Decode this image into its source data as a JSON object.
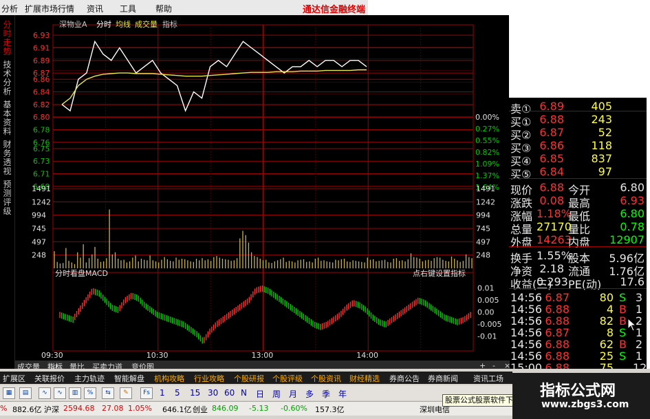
{
  "menu": {
    "items": [
      "分析",
      "扩展市场行情",
      "资讯",
      "工具",
      "帮助"
    ],
    "brand": "通达信金融终端"
  },
  "side_tabs": [
    "分时走势",
    "技术分析",
    "基本资料",
    "财务透视",
    "预测评级"
  ],
  "chart_header": {
    "stock_name": "深物业A",
    "mode": "分时",
    "avg_label": "均线",
    "vol_label": "成交量",
    "indicator_label": "指标"
  },
  "macd_header": {
    "title": "分时看盘MACD",
    "hint": "点右键设置指标"
  },
  "chart_data": [
    {
      "type": "line",
      "title": "",
      "xlabel": "",
      "ylabel": "",
      "price_ticks_left": [
        "6.93",
        "6.91",
        "6.89",
        "6.87",
        "6.86",
        "6.84",
        "6.82",
        "6.80",
        "6.78",
        "6.76",
        "6.75",
        "6.73",
        "6.71",
        "6.69"
      ],
      "pct_ticks_right": [
        "0.00%",
        "0.27%",
        "0.55%",
        "0.82%",
        "1.09%",
        "1.37%",
        "1.64%"
      ],
      "x_ticks": [
        "09:30",
        "10:30",
        "13:00",
        "14:00"
      ],
      "ylim": [
        6.68,
        6.94
      ],
      "prev_close": 6.8,
      "series": [
        {
          "values": [
            6.82,
            6.81,
            6.86,
            6.87,
            6.92,
            6.9,
            6.89,
            6.91,
            6.89,
            6.87,
            6.88,
            6.89,
            6.87,
            6.86,
            6.85,
            6.81,
            6.84,
            6.83,
            6.88,
            6.89,
            6.88,
            6.9,
            6.92,
            6.91,
            6.9,
            6.89,
            6.88,
            6.87,
            6.88,
            6.88,
            6.89,
            6.88,
            6.89,
            6.89,
            6.88,
            6.89,
            6.89,
            6.88
          ]
        },
        {
          "values": [
            6.82,
            6.83,
            6.85,
            6.86,
            6.865,
            6.868,
            6.869,
            6.87,
            6.87,
            6.869,
            6.869,
            6.869,
            6.868,
            6.867,
            6.866,
            6.865,
            6.865,
            6.865,
            6.866,
            6.867,
            6.868,
            6.869,
            6.87,
            6.871,
            6.871,
            6.871,
            6.872,
            6.872,
            6.872,
            6.873,
            6.873,
            6.873,
            6.874,
            6.874,
            6.874,
            6.874,
            6.875,
            6.875
          ]
        }
      ]
    },
    {
      "type": "bar",
      "title": "",
      "y_ticks": [
        "1491",
        "1242",
        "994",
        "745",
        "497",
        "248"
      ],
      "ylim": [
        0,
        1491
      ],
      "values": [
        320,
        120,
        90,
        100,
        380,
        140,
        110,
        80,
        300,
        200,
        450,
        110,
        190,
        260,
        400,
        180,
        120,
        130,
        190,
        1100,
        260,
        300,
        180,
        150,
        160,
        110,
        130,
        200,
        240,
        130,
        180,
        160,
        150,
        240,
        150,
        130,
        110,
        160,
        210,
        170,
        140,
        130,
        200,
        160,
        180,
        170,
        150,
        130,
        120,
        180,
        150,
        190,
        150,
        170,
        140,
        210,
        230,
        200,
        180,
        170,
        160,
        140,
        150,
        190,
        560,
        700,
        620,
        480,
        300,
        230,
        210,
        180,
        150,
        160,
        110,
        100,
        130,
        150,
        170,
        200,
        120,
        140,
        130,
        110,
        150,
        160,
        170,
        120,
        130,
        110,
        180,
        200,
        140,
        150,
        130,
        120,
        110,
        160,
        150,
        170,
        180,
        130,
        120,
        150,
        140,
        130,
        120,
        110,
        200,
        160,
        170,
        130,
        140,
        150,
        160,
        120,
        110,
        180,
        190,
        140,
        150,
        130,
        170,
        280,
        210,
        200,
        180,
        130,
        150,
        160,
        140,
        190,
        210,
        200,
        160,
        140,
        130,
        220,
        180,
        150,
        120,
        140,
        260,
        210,
        190
      ]
    },
    {
      "type": "line",
      "title": "",
      "y_ticks": [
        "0.01",
        "0.005",
        "0.00",
        "-0.005",
        "-0.01"
      ],
      "ylim": [
        -0.0125,
        0.0135
      ],
      "values": [
        0.0,
        -0.001,
        -0.002,
        0.002,
        0.006,
        0.01,
        0.009,
        0.006,
        0.003,
        0.002,
        0.006,
        0.008,
        0.007,
        0.004,
        0.002,
        0.0,
        -0.001,
        -0.002,
        -0.003,
        -0.004,
        -0.006,
        -0.008,
        -0.011,
        -0.007,
        -0.004,
        -0.002,
        0.0,
        0.002,
        0.004,
        0.006,
        0.01,
        0.011,
        0.01,
        0.008,
        0.006,
        0.004,
        0.002,
        0.0,
        -0.002,
        -0.004,
        -0.005,
        -0.004,
        -0.002,
        0.0,
        0.003,
        0.005,
        0.004,
        0.002,
        -0.001,
        -0.003,
        -0.004,
        -0.002,
        0.0,
        0.002,
        0.004,
        0.006,
        0.005,
        0.003,
        0.001,
        -0.001,
        -0.002,
        -0.003,
        -0.002,
        0.0
      ]
    }
  ],
  "quote_panel": {
    "asks": [
      {
        "label": "卖①",
        "price": "6.89",
        "vol": "405"
      }
    ],
    "bids": [
      {
        "label": "买①",
        "price": "6.88",
        "vol": "243"
      },
      {
        "label": "买②",
        "price": "6.87",
        "vol": "52"
      },
      {
        "label": "买③",
        "price": "6.86",
        "vol": "118"
      },
      {
        "label": "买④",
        "price": "6.85",
        "vol": "837"
      },
      {
        "label": "买⑤",
        "price": "6.84",
        "vol": "97"
      }
    ],
    "stats": [
      {
        "l1": "现价",
        "v1": "6.88",
        "l2": "今开",
        "v2": "6.80"
      },
      {
        "l1": "涨跌",
        "v1": "0.08",
        "l2": "最高",
        "v2": "6.93"
      },
      {
        "l1": "涨幅",
        "v1": "1.18%",
        "l2": "最低",
        "v2": "6.80"
      },
      {
        "l1": "总量",
        "v1": "27170",
        "l2": "量比",
        "v2": "0.78"
      },
      {
        "l1": "外盘",
        "v1": "14263",
        "l2": "内盘",
        "v2": "12907"
      }
    ],
    "stats2": [
      {
        "l1": "换手",
        "v1": "1.55%",
        "l2": "股本",
        "v2": "5.96亿"
      },
      {
        "l1": "净资",
        "v1": "2.18",
        "l2": "流通",
        "v2": "1.76亿"
      },
      {
        "l1": "收益(三)",
        "v1": "0.293",
        "l2": "PE(动)",
        "v2": "17.6"
      }
    ],
    "ticks": [
      {
        "time": "14:56",
        "price": "6.87",
        "vol": "80",
        "side": "S",
        "n": "3"
      },
      {
        "time": "14:56",
        "price": "6.88",
        "vol": "4",
        "side": "B",
        "n": "1"
      },
      {
        "time": "14:56",
        "price": "6.88",
        "vol": "82",
        "side": "B",
        "n": "2"
      },
      {
        "time": "14:56",
        "price": "6.87",
        "vol": "8",
        "side": "S",
        "n": "1"
      },
      {
        "time": "14:56",
        "price": "6.88",
        "vol": "62",
        "side": "B",
        "n": "2"
      },
      {
        "time": "14:56",
        "price": "6.88",
        "vol": "25",
        "side": "S",
        "n": "1"
      },
      {
        "time": "15:00",
        "price": "6.88",
        "vol": "75",
        "side": "",
        "n": "12"
      }
    ]
  },
  "sub_tabs": [
    "成交量",
    "指标",
    "量比",
    "买卖力道",
    "竞价图"
  ],
  "nav_items": [
    "扩展区",
    "关联报价",
    "主力轨迹",
    "智能解盘",
    "机构攻略",
    "行业攻略",
    "个股研报",
    "个股评级",
    "个股资讯",
    "财经精选",
    "券商公告",
    "券商新闻",
    "资讯工场"
  ],
  "period_buttons": [
    "Fs",
    "1",
    "5",
    "15",
    "30",
    "60",
    "N",
    "日",
    "周",
    "月",
    "多",
    "季",
    "年"
  ],
  "status": {
    "pct_left": "%",
    "amount_left": "882.6亿",
    "idx2_name": "沪深",
    "idx2_val": "2594.68",
    "idx2_chg": "27.08",
    "idx2_pct": "1.05%",
    "idx2_amt": "646.1亿",
    "idx3_name": "创业",
    "idx3_val": "846.09",
    "idx3_chg": "-5.13",
    "idx3_pct": "-0.60%",
    "idx3_amt": "157.3亿",
    "right_text": "深圳电信"
  },
  "tooltip": "股票公式股票软件下",
  "watermark": {
    "title": "指标公式网",
    "url": "www.zbgs3.com"
  },
  "colors": {
    "up": "#ff3030",
    "down": "#00c800",
    "grid": "#a00000",
    "price": "#ffffff",
    "avg": "#e6e64c",
    "vol": "#c8b44c"
  }
}
